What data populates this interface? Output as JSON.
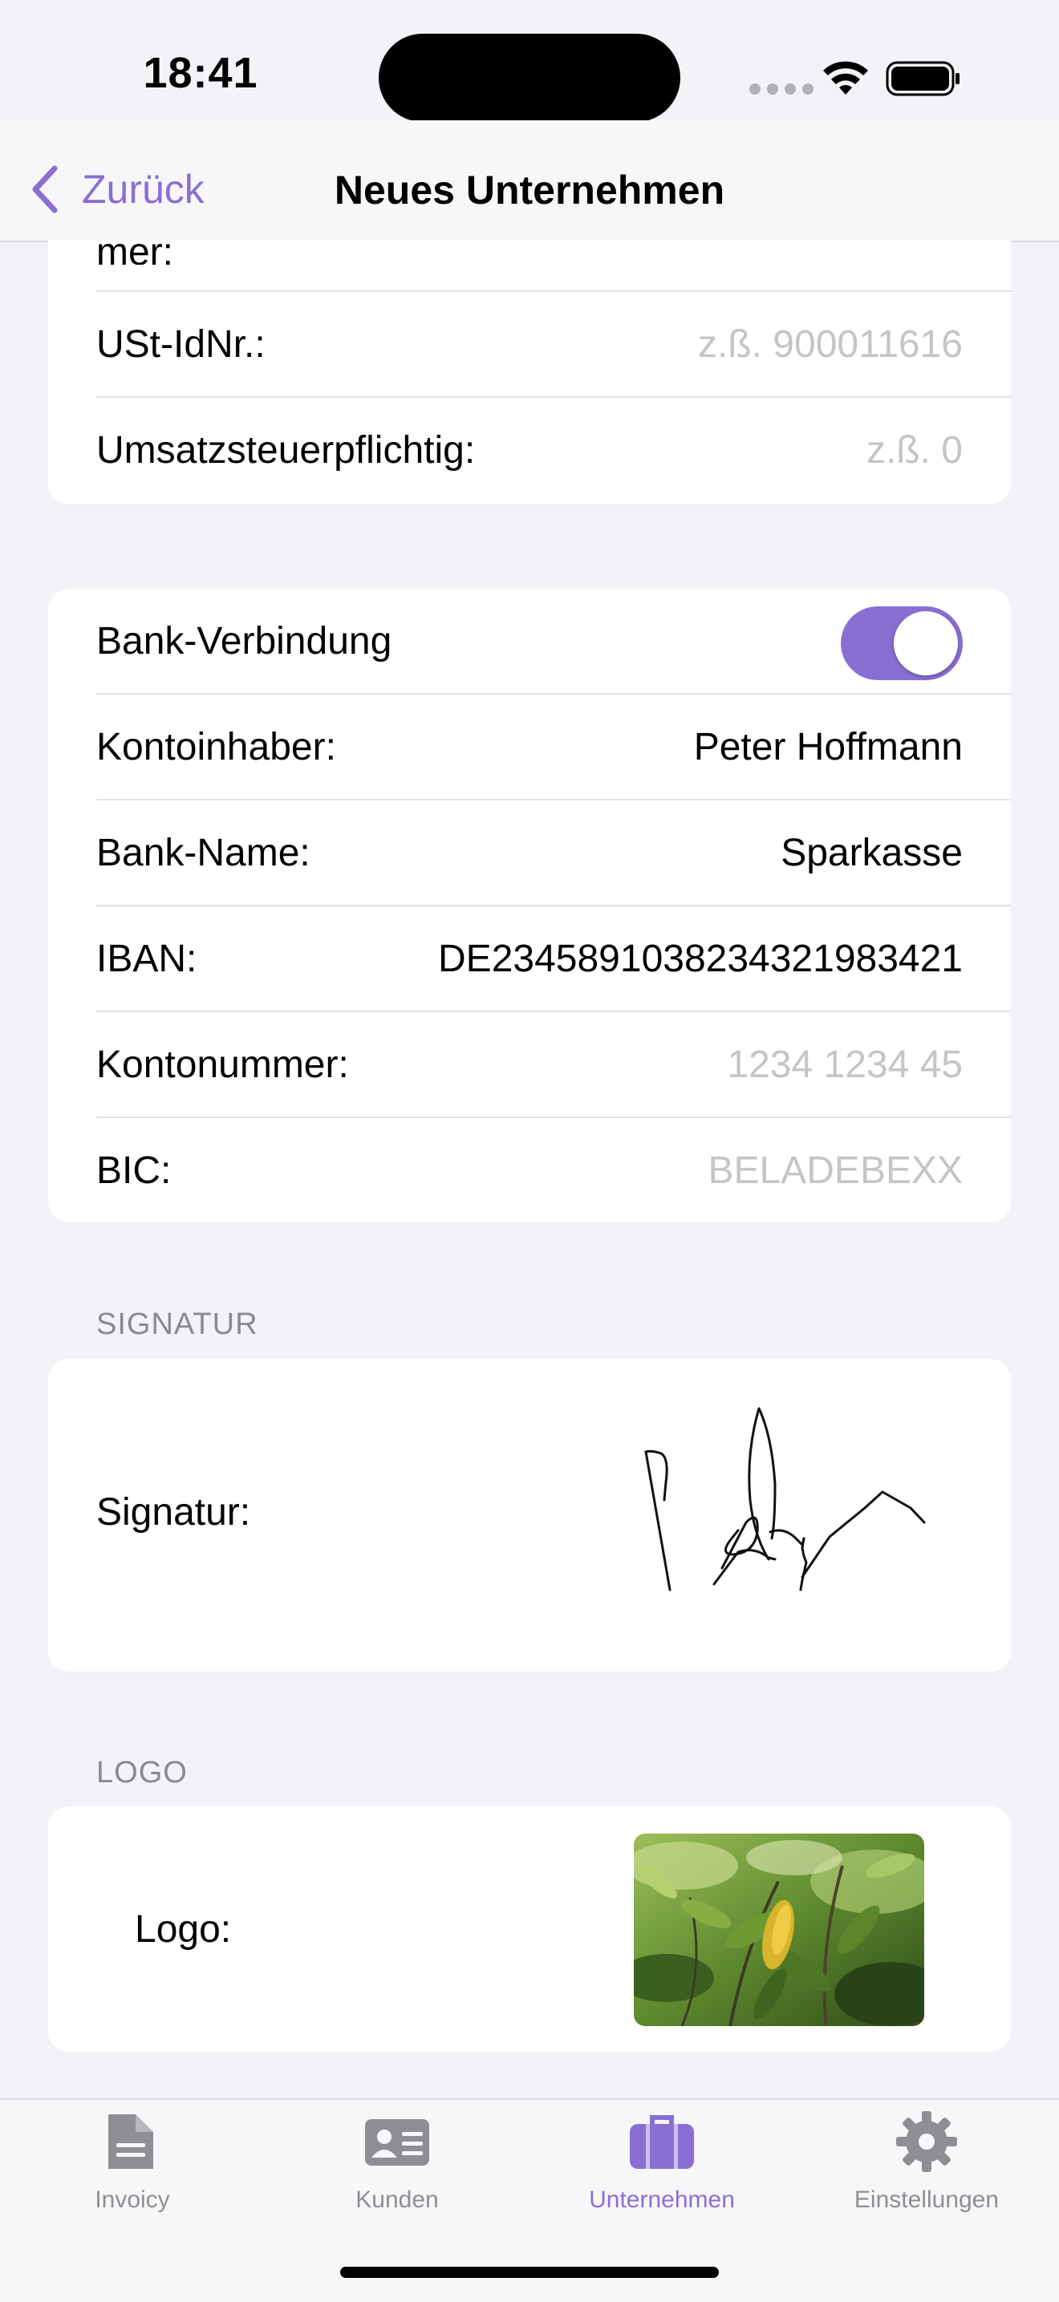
{
  "status_bar": {
    "time": "18:41"
  },
  "nav": {
    "back_label": "Zurück",
    "title": "Neues Unternehmen"
  },
  "tax_section": {
    "partial_label": "mer:",
    "rows": [
      {
        "label": "USt-IdNr.:",
        "placeholder": "z.ß. 900011616"
      },
      {
        "label": "Umsatzsteuerpflichtig:",
        "placeholder": "z.ß. 0"
      }
    ]
  },
  "bank_section": {
    "toggle_label": "Bank-Verbindung",
    "toggle_on": true,
    "rows": [
      {
        "label": "Kontoinhaber:",
        "value": "Peter Hoffmann"
      },
      {
        "label": "Bank-Name:",
        "value": "Sparkasse"
      },
      {
        "label": "IBAN:",
        "value": "DE2345891038234321983421"
      },
      {
        "label": "Kontonummer:",
        "placeholder": "1234 1234 45"
      },
      {
        "label": "BIC:",
        "placeholder": "BELADEBEXX"
      }
    ]
  },
  "signature_section": {
    "header": "SIGNATUR",
    "label": "Signatur:"
  },
  "logo_section": {
    "header": "LOGO",
    "label": "Logo:"
  },
  "tabs": [
    {
      "label": "Invoicy",
      "icon": "document-icon",
      "active": false
    },
    {
      "label": "Kunden",
      "icon": "contact-card-icon",
      "active": false
    },
    {
      "label": "Unternehmen",
      "icon": "briefcase-icon",
      "active": true
    },
    {
      "label": "Einstellungen",
      "icon": "gear-icon",
      "active": false
    }
  ],
  "colors": {
    "accent": "#8A6FD3",
    "background": "#F2F2F7",
    "placeholder": "#C5C5C9",
    "tab_inactive": "#8E8E93"
  }
}
